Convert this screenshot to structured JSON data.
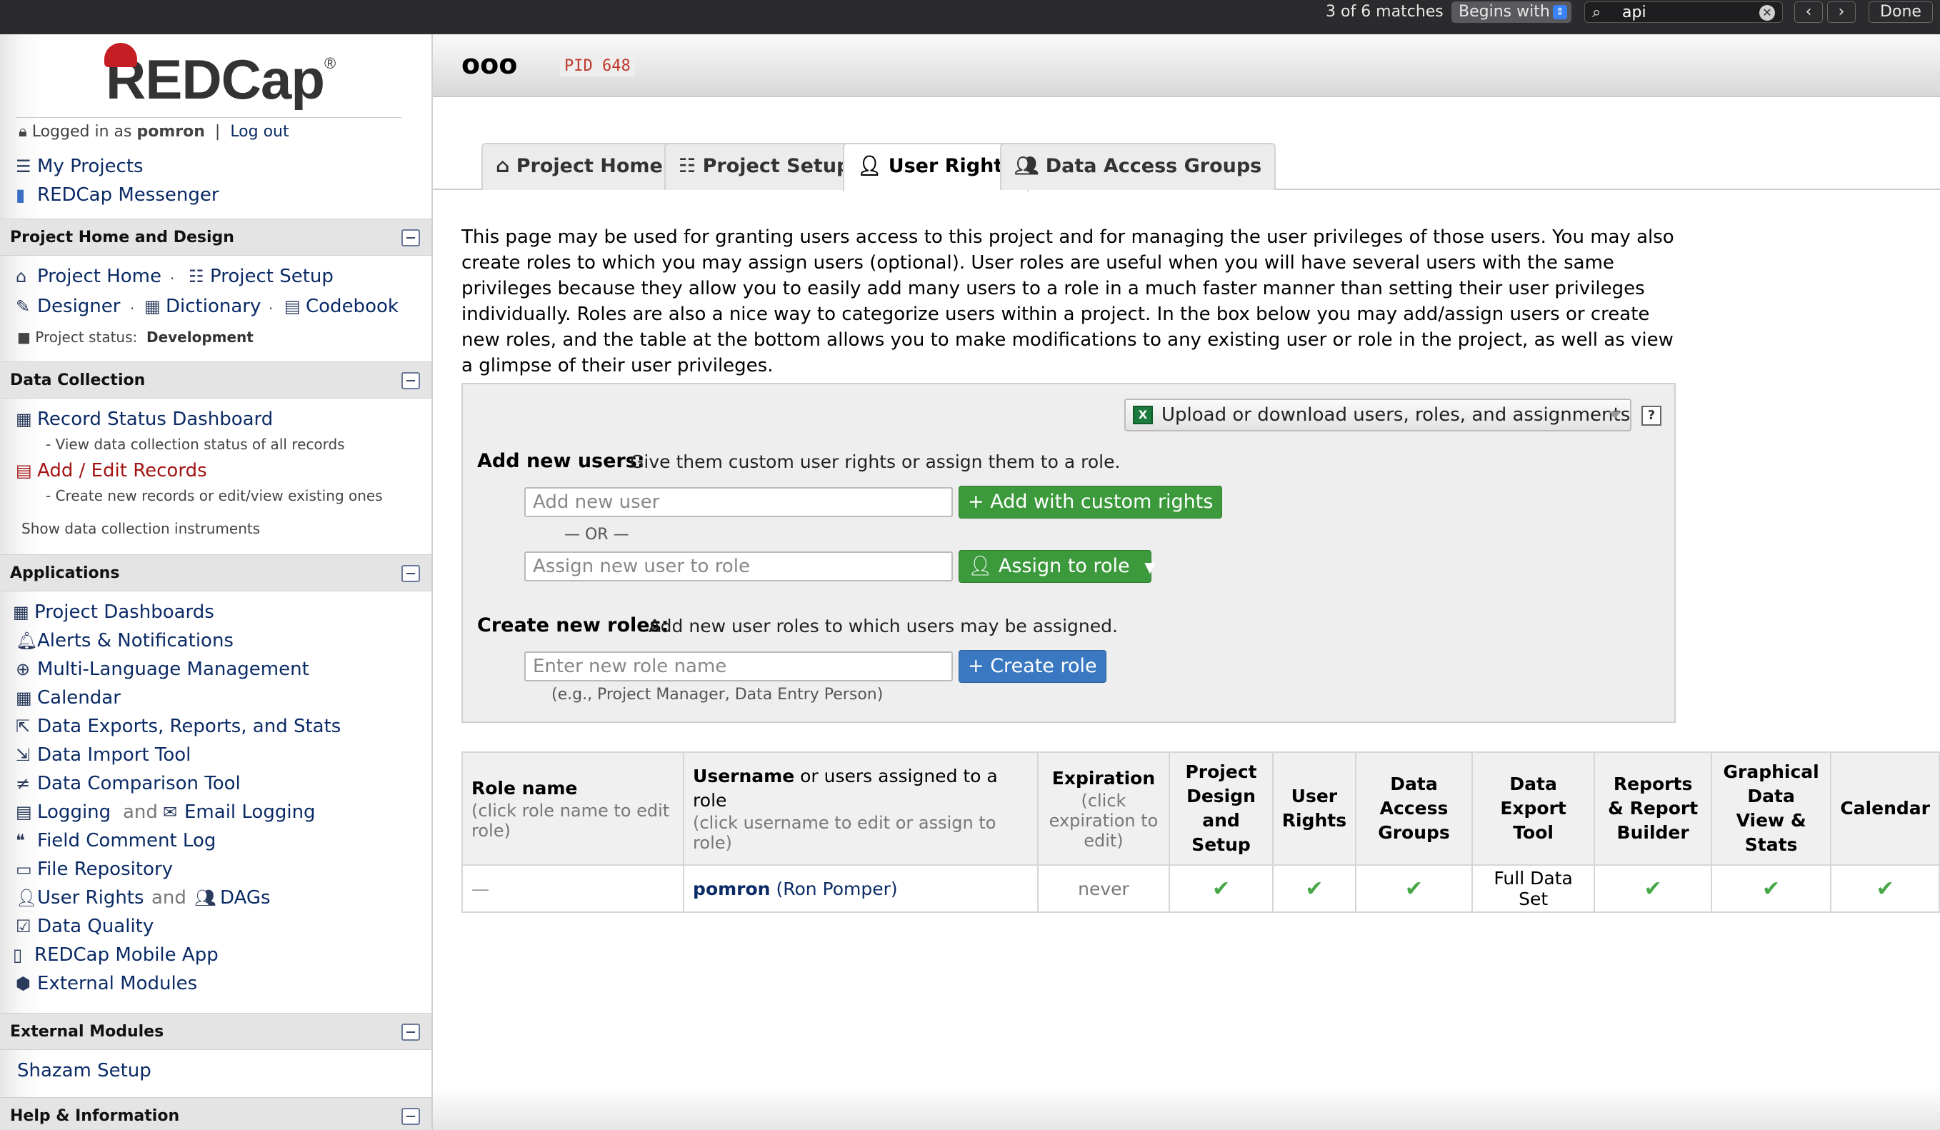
{
  "findbar": {
    "match_count": "3 of 6 matches",
    "mode": "Begins with",
    "query": "api",
    "done_label": "Done"
  },
  "sidebar": {
    "logo_text": "REDCap",
    "logged_in_prefix": "Logged in as",
    "username": "pomron",
    "separator": "|",
    "logout": "Log out",
    "top_links": [
      {
        "label": "My Projects",
        "icon": "list-icon"
      },
      {
        "label": "REDCap Messenger",
        "icon": "chat-icon"
      }
    ],
    "sections": {
      "project_home": {
        "title": "Project Home and Design",
        "links": {
          "home": "Project Home",
          "setup": "Project Setup",
          "designer": "Designer",
          "dictionary": "Dictionary",
          "codebook": "Codebook"
        },
        "status_label": "Project status:",
        "status_value": "Development"
      },
      "data_collection": {
        "title": "Data Collection",
        "record_status": "Record Status Dashboard",
        "record_status_desc": "- View data collection status of all records",
        "add_edit": "Add / Edit Records",
        "add_edit_desc": "- Create new records or edit/view existing ones",
        "show_instruments": "Show data collection instruments"
      },
      "applications": {
        "title": "Applications",
        "items": [
          "Project Dashboards",
          "Alerts & Notifications",
          "Multi-Language Management",
          "Calendar",
          "Data Exports, Reports, and Stats",
          "Data Import Tool",
          "Data Comparison Tool",
          "Logging",
          "Field Comment Log",
          "File Repository",
          "User Rights",
          "Data Quality",
          "REDCap Mobile App",
          "External Modules"
        ],
        "and": "and",
        "email_logging": "Email Logging",
        "dags": "DAGs"
      },
      "external_modules": {
        "title": "External Modules",
        "items": [
          "Shazam Setup"
        ]
      },
      "help": {
        "title": "Help & Information"
      }
    }
  },
  "header": {
    "project_title": "ooo",
    "pid": "PID 648"
  },
  "tabs": [
    {
      "label": "Project Home",
      "icon": "home-icon"
    },
    {
      "label": "Project Setup",
      "icon": "checklist-icon"
    },
    {
      "label": "User Rights",
      "icon": "user-icon"
    },
    {
      "label": "Data Access Groups",
      "icon": "users-icon"
    }
  ],
  "intro_text": "This page may be used for granting users access to this project and for managing the user privileges of those users. You may also create roles to which you may assign users (optional). User roles are useful when you will have several users with the same privileges because they allow you to easily add many users to a role in a much faster manner than setting their user privileges individually. Roles are also a nice way to categorize users within a project. In the box below you may add/assign users or create new roles, and the table at the bottom allows you to make modifications to any existing user or role in the project, as well as view a glimpse of their user privileges.",
  "add_panel": {
    "upload_dropdown": "Upload or download users, roles, and assignments",
    "help": "?",
    "add_users_label": "Add new users:",
    "add_users_desc": "Give them custom user rights or assign them to a role.",
    "add_user_placeholder": "Add new user",
    "add_custom_button": "+ Add with custom rights",
    "or_label": "— OR —",
    "assign_placeholder": "Assign new user to role",
    "assign_button": "Assign to role",
    "create_roles_label": "Create new roles:",
    "create_roles_desc": "Add new user roles to which users may be assigned.",
    "role_placeholder": "Enter new role name",
    "create_role_button": "+ Create role",
    "example": "(e.g., Project Manager, Data Entry Person)"
  },
  "table": {
    "headers": {
      "role_name": "Role name",
      "role_name_sub": "(click role name to edit role)",
      "username": "Username",
      "username_suffix": " or users assigned to a role",
      "username_sub": "(click username to edit or assign to role)",
      "expiration": "Expiration",
      "expiration_sub": "(click expiration to edit)",
      "project_design": "Project Design and Setup",
      "user_rights": "User Rights",
      "dag": "Data Access Groups",
      "data_export": "Data Export Tool",
      "reports": "Reports & Report Builder",
      "graphical": "Graphical Data View & Stats",
      "calendar": "Calendar"
    },
    "rows": [
      {
        "role": "—",
        "username": "pomron",
        "fullname": "(Ron Pomper)",
        "expiration": "never",
        "data_export": "Full Data Set"
      }
    ]
  }
}
